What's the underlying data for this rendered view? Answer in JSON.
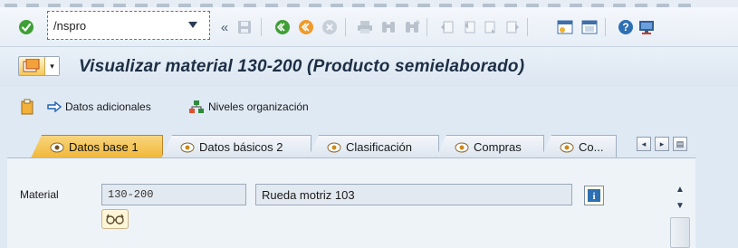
{
  "toolbar": {
    "command_field": {
      "value": "/nspro",
      "placeholder": ""
    },
    "nav_prefix": "«",
    "icons": [
      "enter-icon",
      "save-icon",
      "back-icon",
      "exit-icon",
      "cancel-icon",
      "print-icon",
      "find-icon",
      "find-next-icon",
      "first-page-icon",
      "prev-page-icon",
      "next-page-icon",
      "last-page-icon",
      "create-session-icon",
      "shortcut-icon",
      "help-icon",
      "layout-icon"
    ]
  },
  "title_bar": {
    "title": "Visualizar material 130-200 (Producto semielaborado)"
  },
  "app_toolbar": {
    "additional_data": "Datos adicionales",
    "org_levels": "Niveles organización"
  },
  "tabs": [
    {
      "label": "Datos base 1",
      "active": true
    },
    {
      "label": "Datos básicos 2",
      "active": false
    },
    {
      "label": "Clasificación",
      "active": false
    },
    {
      "label": "Compras",
      "active": false
    },
    {
      "label": "Co...",
      "active": false
    }
  ],
  "tab_nav": {
    "left": "◂",
    "right": "▸",
    "list": "▤"
  },
  "content": {
    "material_label": "Material",
    "material_number": "130-200",
    "material_description": "Rueda motriz 103",
    "info_icon_label": "i"
  },
  "scrollbar": {
    "up": "▲",
    "down": "▼"
  },
  "colors": {
    "background": "#dfe9f4",
    "active_tab": "#f0b73a",
    "title_text": "#1d2f45",
    "enter_green": "#3f9f36",
    "help_blue": "#2d6fb3"
  }
}
